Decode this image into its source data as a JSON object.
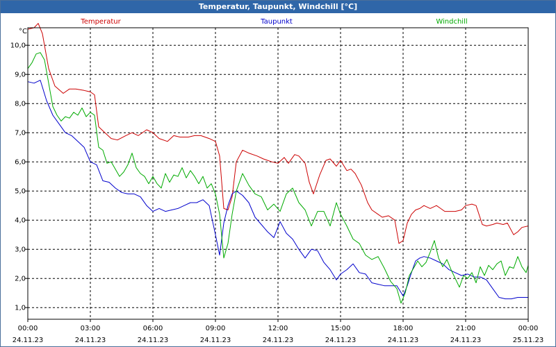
{
  "window": {
    "title": "Temperatur, Taupunkt, Windchill [°C]"
  },
  "chart_data": {
    "type": "line",
    "title": "Temperatur, Taupunkt, Windchill [°C]",
    "ylabel": "°C",
    "ylim": [
      0.6,
      10.6
    ],
    "yticks": [
      "1,0",
      "2,0",
      "3,0",
      "4,0",
      "5,0",
      "6,0",
      "7,0",
      "8,0",
      "9,0",
      "10,0"
    ],
    "ytick_values": [
      1,
      2,
      3,
      4,
      5,
      6,
      7,
      8,
      9,
      10
    ],
    "xlim_hours": [
      0,
      24
    ],
    "xticks": [
      {
        "time": "00:00",
        "date": "24.11.23"
      },
      {
        "time": "03:00",
        "date": "24.11.23"
      },
      {
        "time": "06:00",
        "date": "24.11.23"
      },
      {
        "time": "09:00",
        "date": "24.11.23"
      },
      {
        "time": "12:00",
        "date": "24.11.23"
      },
      {
        "time": "15:00",
        "date": "24.11.23"
      },
      {
        "time": "18:00",
        "date": "24.11.23"
      },
      {
        "time": "21:00",
        "date": "24.11.23"
      },
      {
        "time": "00:00",
        "date": "25.11.23"
      }
    ],
    "grid": true,
    "legend_position": "top",
    "series": [
      {
        "name": "Temperatur",
        "color": "#cc0000",
        "x": [
          0,
          0.3,
          0.5,
          0.7,
          1.0,
          1.3,
          1.7,
          2.0,
          2.3,
          2.7,
          3.0,
          3.2,
          3.4,
          3.7,
          4.0,
          4.3,
          4.7,
          5.0,
          5.3,
          5.7,
          6.0,
          6.3,
          6.7,
          7.0,
          7.3,
          7.7,
          8.0,
          8.3,
          8.7,
          9.0,
          9.2,
          9.4,
          9.6,
          9.8,
          10.0,
          10.3,
          10.6,
          11.0,
          11.3,
          11.7,
          12.0,
          12.3,
          12.5,
          12.8,
          13.0,
          13.3,
          13.5,
          13.7,
          14.0,
          14.3,
          14.5,
          14.8,
          15.0,
          15.3,
          15.5,
          15.7,
          16.0,
          16.3,
          16.5,
          16.8,
          17.0,
          17.3,
          17.6,
          17.8,
          18.0,
          18.2,
          18.4,
          18.6,
          18.8,
          19.0,
          19.3,
          19.6,
          19.8,
          20.0,
          20.3,
          20.5,
          20.8,
          21.0,
          21.3,
          21.5,
          21.8,
          22.0,
          22.3,
          22.5,
          22.8,
          23.0,
          23.3,
          23.5,
          23.7,
          24.0
        ],
        "values": [
          10.55,
          10.6,
          10.75,
          10.4,
          9.2,
          8.6,
          8.35,
          8.5,
          8.5,
          8.45,
          8.4,
          8.3,
          7.2,
          7.0,
          6.8,
          6.75,
          6.9,
          7.0,
          6.9,
          7.1,
          7.0,
          6.8,
          6.7,
          6.9,
          6.85,
          6.85,
          6.9,
          6.9,
          6.8,
          6.7,
          6.2,
          4.4,
          4.35,
          4.8,
          6.0,
          6.4,
          6.3,
          6.2,
          6.1,
          6.0,
          5.95,
          6.15,
          5.95,
          6.25,
          6.2,
          5.95,
          5.3,
          4.9,
          5.55,
          6.05,
          6.1,
          5.85,
          6.05,
          5.7,
          5.75,
          5.6,
          5.2,
          4.6,
          4.35,
          4.2,
          4.1,
          4.15,
          4.0,
          3.2,
          3.3,
          3.9,
          4.2,
          4.35,
          4.4,
          4.5,
          4.4,
          4.5,
          4.4,
          4.3,
          4.3,
          4.3,
          4.35,
          4.5,
          4.55,
          4.5,
          3.85,
          3.8,
          3.85,
          3.9,
          3.85,
          3.9,
          3.5,
          3.6,
          3.75,
          3.8
        ]
      },
      {
        "name": "Taupunkt",
        "color": "#0000cc",
        "x": [
          0,
          0.3,
          0.6,
          0.9,
          1.2,
          1.5,
          1.8,
          2.1,
          2.4,
          2.7,
          3.0,
          3.3,
          3.6,
          3.9,
          4.2,
          4.5,
          4.8,
          5.1,
          5.4,
          5.7,
          6.0,
          6.3,
          6.6,
          6.9,
          7.2,
          7.5,
          7.8,
          8.1,
          8.4,
          8.7,
          9.0,
          9.2,
          9.4,
          9.6,
          9.8,
          10.0,
          10.3,
          10.6,
          10.9,
          11.2,
          11.5,
          11.8,
          12.1,
          12.4,
          12.7,
          13.0,
          13.3,
          13.6,
          13.9,
          14.2,
          14.5,
          14.8,
          15.0,
          15.3,
          15.6,
          15.9,
          16.2,
          16.5,
          16.8,
          17.1,
          17.4,
          17.7,
          18.0,
          18.2,
          18.4,
          18.6,
          18.8,
          19.0,
          19.3,
          19.6,
          19.9,
          20.2,
          20.5,
          20.8,
          21.1,
          21.4,
          21.7,
          22.0,
          22.3,
          22.6,
          22.9,
          23.2,
          23.5,
          23.8,
          24.0
        ],
        "values": [
          8.75,
          8.7,
          8.8,
          8.1,
          7.6,
          7.3,
          7.0,
          6.9,
          6.7,
          6.5,
          6.0,
          5.9,
          5.35,
          5.3,
          5.1,
          4.95,
          4.9,
          4.9,
          4.8,
          4.5,
          4.3,
          4.4,
          4.3,
          4.35,
          4.4,
          4.5,
          4.6,
          4.6,
          4.7,
          4.5,
          3.5,
          2.8,
          3.9,
          4.5,
          4.9,
          5.0,
          4.85,
          4.6,
          4.1,
          3.85,
          3.6,
          3.4,
          3.95,
          3.55,
          3.35,
          3.0,
          2.7,
          3.0,
          2.95,
          2.55,
          2.3,
          1.95,
          2.15,
          2.3,
          2.5,
          2.2,
          2.15,
          1.85,
          1.8,
          1.75,
          1.75,
          1.75,
          1.4,
          1.75,
          2.2,
          2.6,
          2.7,
          2.75,
          2.7,
          2.6,
          2.5,
          2.3,
          2.2,
          2.1,
          2.15,
          2.05,
          2.05,
          1.95,
          1.65,
          1.35,
          1.3,
          1.3,
          1.35,
          1.35,
          1.35
        ]
      },
      {
        "name": "Windchill",
        "color": "#00aa00",
        "x": [
          0,
          0.2,
          0.4,
          0.6,
          0.8,
          1.0,
          1.2,
          1.4,
          1.6,
          1.8,
          2.0,
          2.2,
          2.4,
          2.6,
          2.8,
          3.0,
          3.2,
          3.4,
          3.6,
          3.8,
          4.0,
          4.2,
          4.4,
          4.6,
          4.8,
          5.0,
          5.2,
          5.4,
          5.6,
          5.8,
          6.0,
          6.2,
          6.4,
          6.6,
          6.8,
          7.0,
          7.2,
          7.4,
          7.6,
          7.8,
          8.0,
          8.2,
          8.4,
          8.6,
          8.8,
          9.0,
          9.2,
          9.4,
          9.6,
          9.8,
          10.0,
          10.3,
          10.6,
          10.9,
          11.2,
          11.5,
          11.8,
          12.1,
          12.4,
          12.7,
          13.0,
          13.3,
          13.6,
          13.9,
          14.2,
          14.5,
          14.8,
          15.0,
          15.3,
          15.6,
          15.9,
          16.2,
          16.5,
          16.8,
          17.1,
          17.4,
          17.7,
          17.9,
          18.1,
          18.3,
          18.5,
          18.7,
          18.9,
          19.1,
          19.3,
          19.5,
          19.7,
          19.9,
          20.1,
          20.3,
          20.5,
          20.7,
          20.9,
          21.1,
          21.3,
          21.5,
          21.7,
          21.9,
          22.1,
          22.3,
          22.5,
          22.7,
          22.9,
          23.1,
          23.3,
          23.5,
          23.7,
          23.9,
          24.0
        ],
        "values": [
          9.2,
          9.4,
          9.7,
          9.75,
          9.5,
          8.7,
          7.9,
          7.6,
          7.4,
          7.55,
          7.5,
          7.7,
          7.6,
          7.85,
          7.55,
          7.7,
          7.6,
          6.5,
          6.4,
          5.95,
          6.0,
          5.75,
          5.5,
          5.65,
          5.9,
          6.3,
          5.8,
          5.6,
          5.5,
          5.25,
          5.5,
          5.25,
          5.1,
          5.6,
          5.3,
          5.55,
          5.5,
          5.8,
          5.45,
          5.7,
          5.5,
          5.25,
          5.5,
          5.1,
          5.25,
          4.9,
          4.2,
          2.7,
          3.2,
          4.2,
          5.0,
          5.6,
          5.2,
          4.9,
          4.8,
          4.35,
          4.55,
          4.3,
          4.9,
          5.1,
          4.6,
          4.35,
          3.8,
          4.3,
          4.3,
          3.8,
          4.6,
          4.2,
          3.8,
          3.35,
          3.2,
          2.8,
          2.65,
          2.75,
          2.35,
          1.9,
          1.65,
          1.15,
          1.5,
          2.1,
          2.35,
          2.6,
          2.4,
          2.55,
          2.9,
          3.3,
          2.7,
          2.4,
          2.65,
          2.3,
          2.0,
          1.7,
          2.1,
          2.0,
          2.2,
          1.85,
          2.4,
          2.1,
          2.45,
          2.3,
          2.5,
          2.6,
          2.1,
          2.4,
          2.35,
          2.75,
          2.4,
          2.2,
          2.45
        ]
      }
    ]
  }
}
